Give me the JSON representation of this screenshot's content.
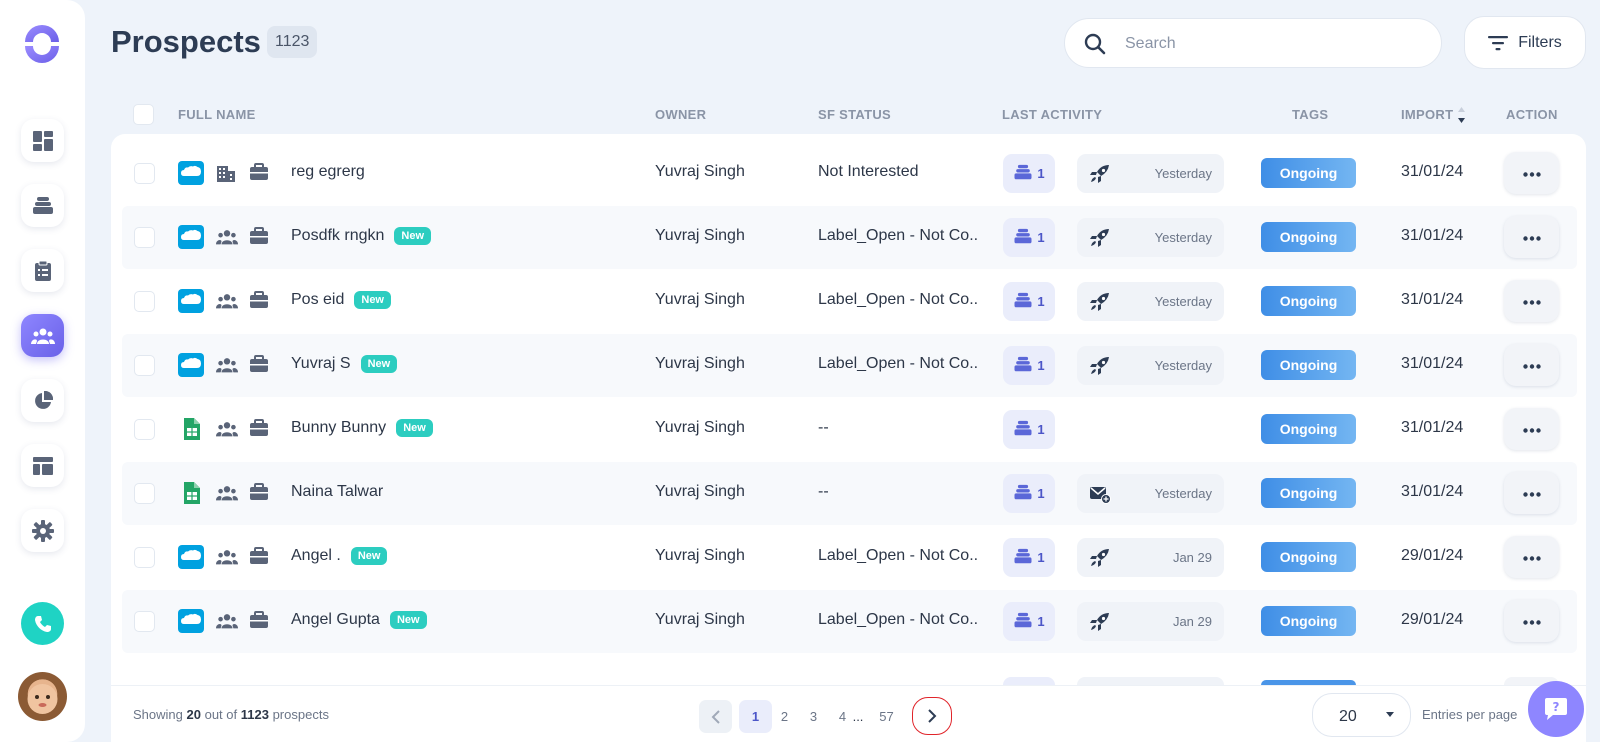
{
  "page": {
    "title": "Prospects",
    "count": "1123"
  },
  "search": {
    "placeholder": "Search",
    "value": ""
  },
  "filters_label": "Filters",
  "columns": {
    "full_name": "FULL NAME",
    "owner": "OWNER",
    "sf_status": "SF STATUS",
    "last_activity": "LAST ACTIVITY",
    "tags": "TAGS",
    "import": "IMPORT",
    "action": "ACTION"
  },
  "new_badge": "New",
  "rows": [
    {
      "source": "salesforce-icon",
      "type": "building-icon",
      "name": "reg egrerg",
      "is_new": false,
      "owner": "Yuvraj Singh",
      "sf_status": "Not Interested",
      "seq_count": "1",
      "activity_icon": "rocket-icon",
      "activity_time": "Yesterday",
      "tag": "Ongoing",
      "import": "31/01/24"
    },
    {
      "source": "salesforce-icon",
      "type": "people-icon",
      "name": "Posdfk rngkn",
      "is_new": true,
      "owner": "Yuvraj Singh",
      "sf_status": "Label_Open - Not Co...",
      "seq_count": "1",
      "activity_icon": "rocket-icon",
      "activity_time": "Yesterday",
      "tag": "Ongoing",
      "import": "31/01/24"
    },
    {
      "source": "salesforce-icon",
      "type": "people-icon",
      "name": "Pos eid",
      "is_new": true,
      "owner": "Yuvraj Singh",
      "sf_status": "Label_Open - Not Co...",
      "seq_count": "1",
      "activity_icon": "rocket-icon",
      "activity_time": "Yesterday",
      "tag": "Ongoing",
      "import": "31/01/24"
    },
    {
      "source": "salesforce-icon",
      "type": "people-icon",
      "name": "Yuvraj S",
      "is_new": true,
      "owner": "Yuvraj Singh",
      "sf_status": "Label_Open - Not Co...",
      "seq_count": "1",
      "activity_icon": "rocket-icon",
      "activity_time": "Yesterday",
      "tag": "Ongoing",
      "import": "31/01/24"
    },
    {
      "source": "sheets-icon",
      "type": "people-icon",
      "name": "Bunny Bunny",
      "is_new": true,
      "owner": "Yuvraj Singh",
      "sf_status": "--",
      "seq_count": "1",
      "activity_icon": "",
      "activity_time": "",
      "tag": "Ongoing",
      "import": "31/01/24"
    },
    {
      "source": "sheets-icon",
      "type": "people-icon",
      "name": "Naina Talwar",
      "is_new": false,
      "owner": "Yuvraj Singh",
      "sf_status": "--",
      "seq_count": "1",
      "activity_icon": "mail-icon",
      "activity_time": "Yesterday",
      "tag": "Ongoing",
      "import": "31/01/24"
    },
    {
      "source": "salesforce-icon",
      "type": "people-icon",
      "name": "Angel .",
      "is_new": true,
      "owner": "Yuvraj Singh",
      "sf_status": "Label_Open - Not Co...",
      "seq_count": "1",
      "activity_icon": "rocket-icon",
      "activity_time": "Jan 29",
      "tag": "Ongoing",
      "import": "29/01/24"
    },
    {
      "source": "salesforce-icon",
      "type": "people-icon",
      "name": "Angel Gupta",
      "is_new": true,
      "owner": "Yuvraj Singh",
      "sf_status": "Label_Open - Not Co...",
      "seq_count": "1",
      "activity_icon": "rocket-icon",
      "activity_time": "Jan 29",
      "tag": "Ongoing",
      "import": "29/01/24"
    }
  ],
  "footer": {
    "showing_prefix": "Showing",
    "showing_count": "20",
    "showing_mid": "out of",
    "showing_total": "1123",
    "showing_suffix": "prospects",
    "pages": [
      "1",
      "2",
      "3",
      "4"
    ],
    "ellipsis": "...",
    "last_page": "57",
    "current_page": "1",
    "per_page": "20",
    "per_page_label": "Entries per page"
  },
  "colors": {
    "accent": "#7b73f2",
    "tag": "#4a95e8",
    "new_badge": "#2ccdc0",
    "salesforce": "#00a1e0",
    "sheets": "#23a566"
  }
}
